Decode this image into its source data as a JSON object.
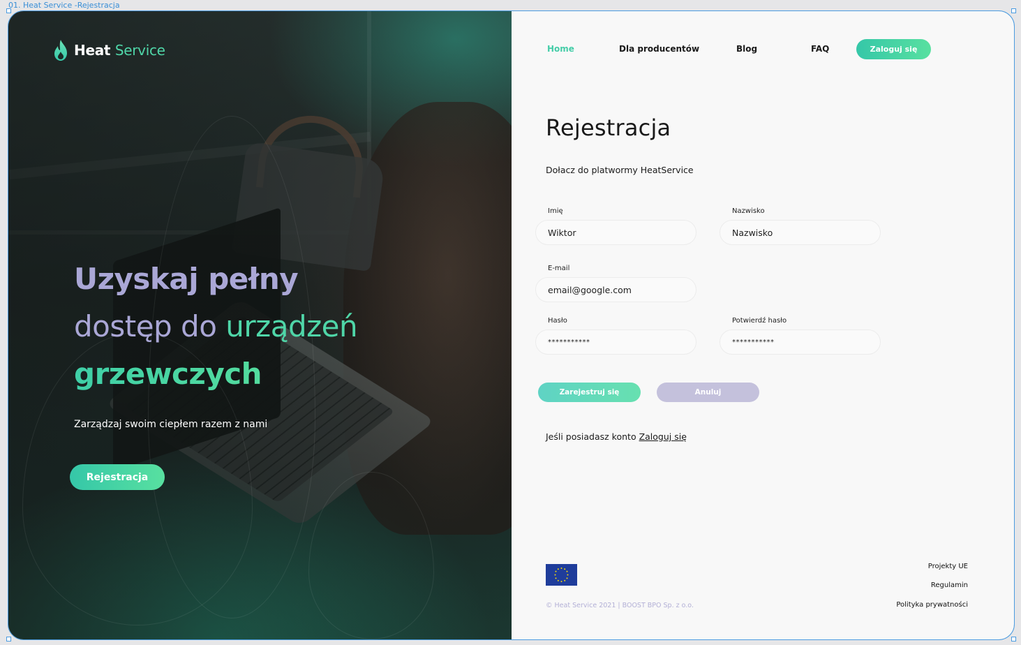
{
  "artboard": {
    "label": "01. Heat Service -Rejestracja"
  },
  "logo": {
    "word1": "Heat",
    "word2": "Service"
  },
  "hero": {
    "line1": "Uzyskaj pełny",
    "line2_a": "dostęp do",
    "line2_b": "urządzeń",
    "line3": "grzewczych",
    "tagline": "Zarządzaj swoim ciepłem razem z nami",
    "cta": "Rejestracja"
  },
  "nav": {
    "items": [
      "Home",
      "Dla producentów",
      "Blog",
      "FAQ"
    ],
    "active": "Home",
    "login": "Zaloguj się"
  },
  "form": {
    "title": "Rejestracja",
    "subtitle": "Dołacz do platwormy HeatService",
    "first_name": {
      "label": "Imię",
      "value": "Wiktor"
    },
    "last_name": {
      "label": "Nazwisko",
      "value": "Nazwisko"
    },
    "email": {
      "label": "E-mail",
      "value": "email@google.com"
    },
    "password": {
      "label": "Hasło",
      "value": "***********"
    },
    "password_confirm": {
      "label": "Potwierdź hasło",
      "value": "***********"
    },
    "submit": "Zarejestruj się",
    "cancel": "Anuluj",
    "have_account_text": "Jeśli posiadasz konto",
    "have_account_link": "Zaloguj się"
  },
  "footer": {
    "copyright": "© Heat Service 2021 | BOOST BPO Sp. z o.o.",
    "links": [
      "Projekty UE",
      "Regulamin",
      "Polityka prywatności"
    ]
  },
  "colors": {
    "accent_green": "#4fd6a8",
    "accent_lavender": "#aaa7d6",
    "eu_blue": "#1f3d9b"
  }
}
